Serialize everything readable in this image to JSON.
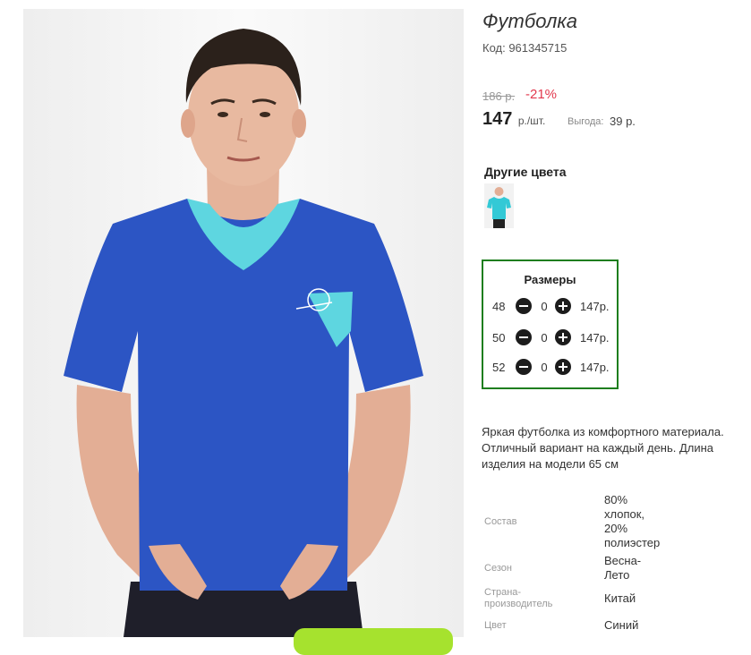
{
  "product": {
    "title": "Футболка",
    "code": "Код: 961345715",
    "old_price": "186 р.",
    "discount": "-21%",
    "price": "147",
    "unit": "р./шт.",
    "benefit_label": "Выгода:",
    "benefit_value": "39 р."
  },
  "other_colors": {
    "title": "Другие цвета",
    "items": [
      {
        "name": "turquoise-tshirt-thumbnail",
        "color": "#33c9d6"
      }
    ]
  },
  "sizes": {
    "title": "Размеры",
    "rows": [
      {
        "size": "48",
        "qty": "0",
        "price": "147р."
      },
      {
        "size": "50",
        "qty": "0",
        "price": "147р."
      },
      {
        "size": "52",
        "qty": "0",
        "price": "147р."
      }
    ]
  },
  "description": {
    "lines": [
      "Яркая футболка из комфортного материала.",
      "Отличный вариант на каждый день. Длина",
      "изделия на модели 65 см"
    ]
  },
  "attributes": [
    {
      "label": "Состав",
      "value_lines": [
        "80%",
        "хлопок,",
        "20%",
        "полиэстер"
      ]
    },
    {
      "label_lines": [
        "Сезон"
      ],
      "value_lines": [
        "Весна-",
        "Лето"
      ]
    },
    {
      "label_lines": [
        "Страна-",
        "производитель"
      ],
      "value_lines": [
        "Китай"
      ]
    },
    {
      "label_lines": [
        "Цвет"
      ],
      "value_lines": [
        "Синий"
      ]
    }
  ],
  "colors": {
    "shirt": "#2c55c4",
    "trim": "#5ed6e0",
    "accent_red": "#e2384d",
    "sizes_border": "#1e7e1e",
    "cart_button": "#a6e22e"
  }
}
